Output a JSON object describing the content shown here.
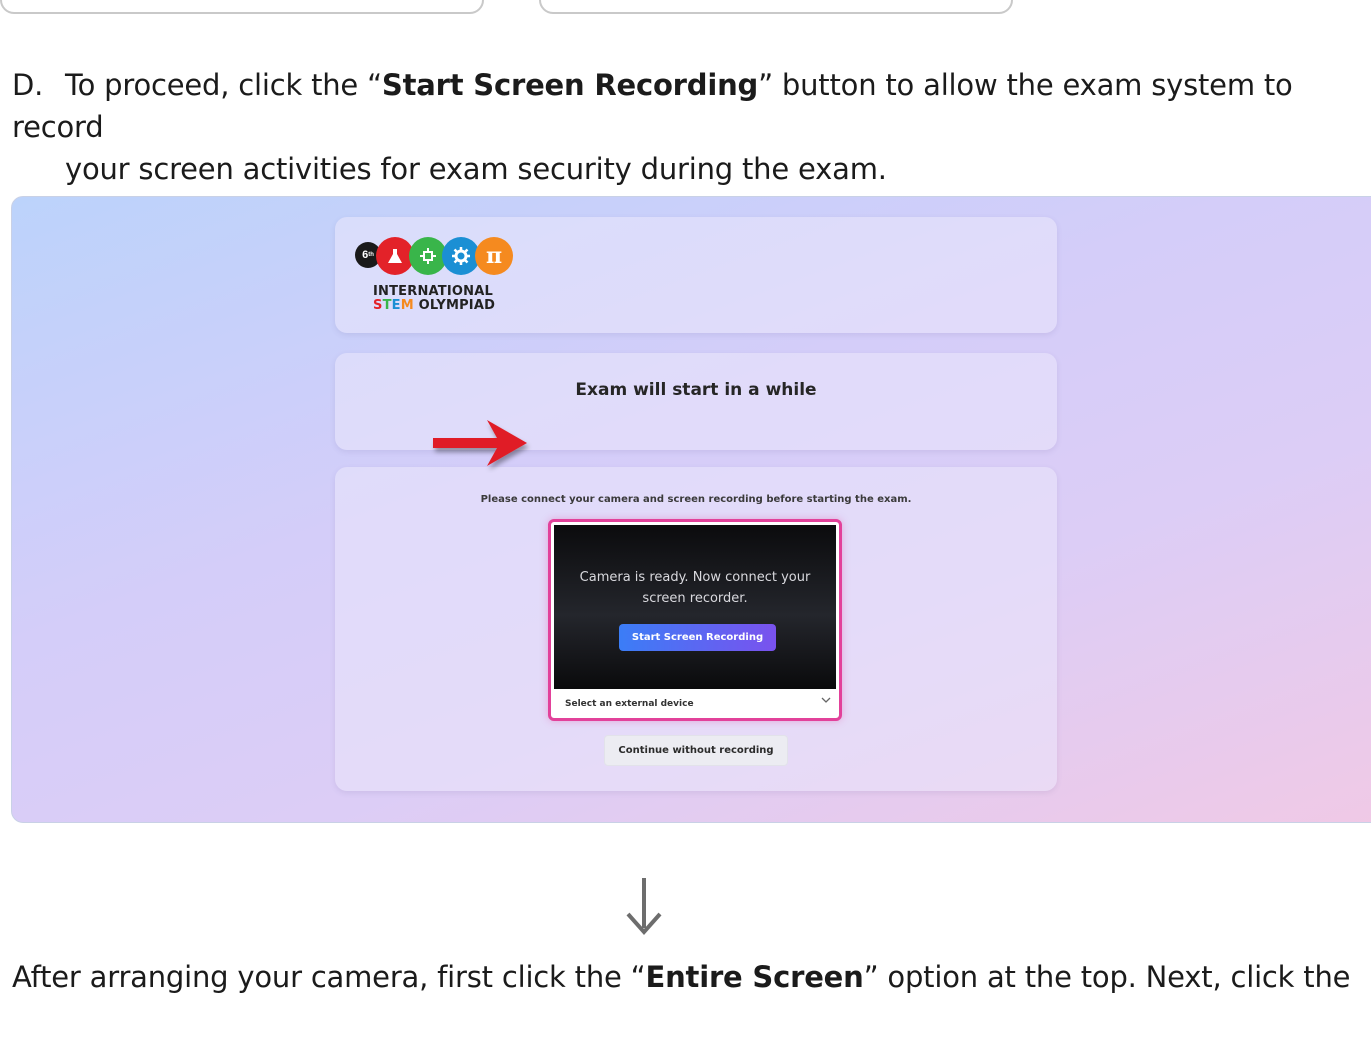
{
  "step_d": {
    "marker": "D.",
    "pre": "To proceed, click the “",
    "bold": "Start Screen Recording",
    "post": "” button to allow the exam system to record",
    "line2": "your screen activities for exam security during the exam."
  },
  "logo": {
    "badge": "6",
    "badge_suffix": "th",
    "pi": "π",
    "line1": "INTERNATIONAL",
    "line2_s": "S",
    "line2_t": "T",
    "line2_e": "E",
    "line2_m": "M",
    "line2_rest": " OLYMPIAD"
  },
  "status": {
    "title": "Exam will start in a while"
  },
  "main": {
    "instruction": "Please connect your camera and screen recording before starting the exam.",
    "camera_message_line1": "Camera is ready. Now connect your",
    "camera_message_line2": "screen recorder.",
    "record_button": "Start Screen Recording",
    "device_select": "Select an external device",
    "continue_button": "Continue without recording"
  },
  "bottom": {
    "pre": "After arranging your camera, first click the “",
    "bold": "Entire Screen",
    "post": "” option at the top. Next, click the"
  },
  "colors": {
    "frame_accent": "#e2419a",
    "record_button_start": "#3b7df6",
    "record_button_end": "#7a52ee",
    "arrow_red": "#e01e26"
  }
}
